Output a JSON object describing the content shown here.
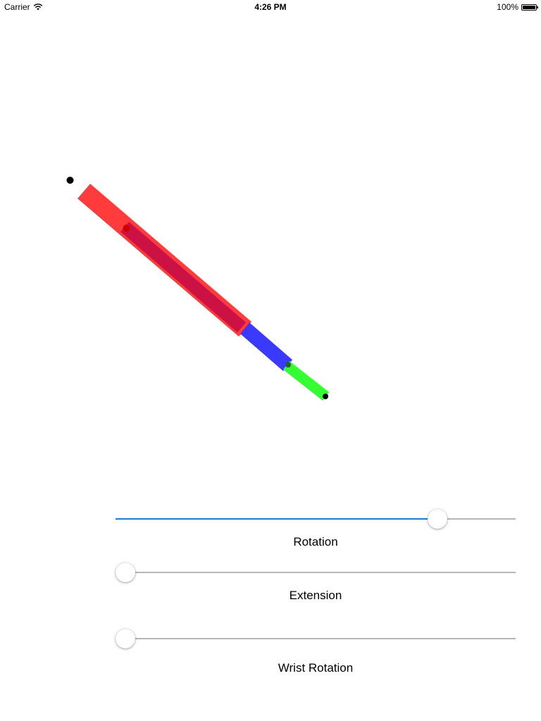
{
  "status_bar": {
    "carrier": "Carrier",
    "time": "4:26 PM",
    "battery": "100%",
    "battery_level": 1.0
  },
  "arm": {
    "segment_colors": {
      "base": "#ff3b3b",
      "extension": "#cc1144",
      "forearm": "#3a3aff",
      "wrist": "#33ff33"
    }
  },
  "controls": {
    "rotation": {
      "label": "Rotation",
      "value": 0.82,
      "accent": "#1a7fd0"
    },
    "extension": {
      "label": "Extension",
      "value": 0.0
    },
    "wrist_rotation": {
      "label": "Wrist Rotation",
      "value": 0.0
    }
  }
}
